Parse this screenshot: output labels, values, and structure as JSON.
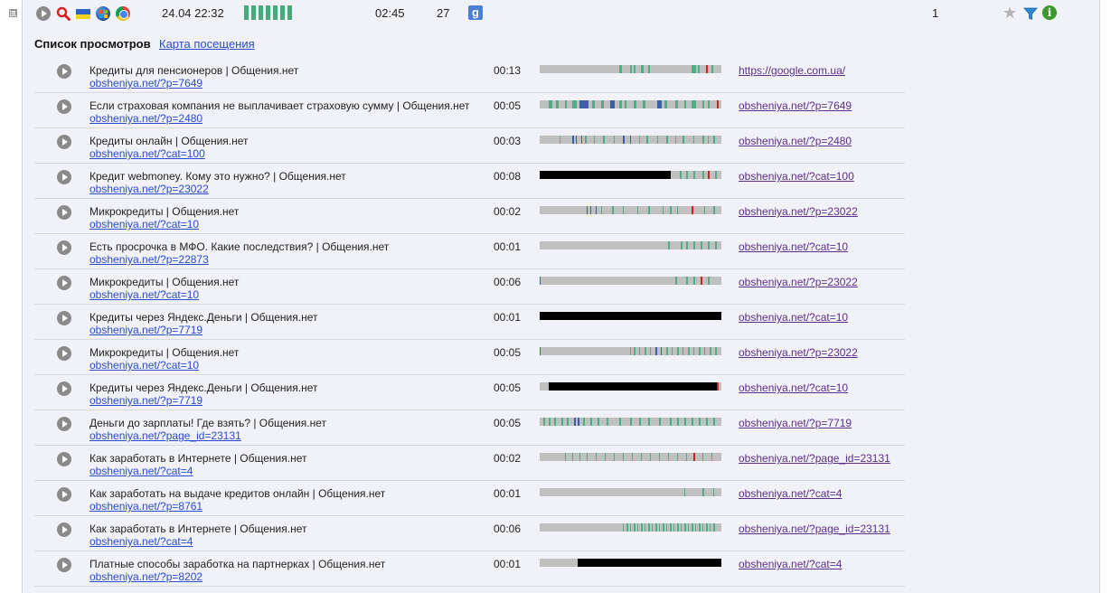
{
  "session": {
    "toggle": "⊟",
    "datetime": "24.04 22:32",
    "activity_bar_count": 7,
    "duration": "02:45",
    "pageviews": "27",
    "search_engine_icon": "g",
    "visits": "1",
    "icons": [
      "play-icon",
      "search-icon",
      "flag-ua-icon",
      "windows7-icon",
      "chrome-icon",
      "google-icon",
      "star-icon",
      "filter-icon",
      "info-icon"
    ]
  },
  "section": {
    "title": "Список просмотров",
    "map_link": "Карта посещения"
  },
  "colors": {
    "link": "#2a4ccc",
    "visited_link": "#5c2f8a",
    "timeline_idle": "#c0c0c0",
    "timeline_active": "#4fae86",
    "timeline_scroll": "#3b5fa8",
    "timeline_click": "#cc2222",
    "timeline_absent": "#000000"
  },
  "views": [
    {
      "title": "Кредиты для пенсионеров | Общения.нет",
      "url": "obsheniya.net/?p=7649",
      "duration": "00:13",
      "referrer": "https://google.com.ua/"
    },
    {
      "title": "Если страховая компания не выплачивает страховую сумму | Общения.нет",
      "url": "obsheniya.net/?p=2480",
      "duration": "00:05",
      "referrer": "obsheniya.net/?p=7649"
    },
    {
      "title": "Кредиты онлайн | Общения.нет",
      "url": "obsheniya.net/?cat=100",
      "duration": "00:03",
      "referrer": "obsheniya.net/?p=2480"
    },
    {
      "title": "Кредит webmoney. Кому это нужно? | Общения.нет",
      "url": "obsheniya.net/?p=23022",
      "duration": "00:08",
      "referrer": "obsheniya.net/?cat=100"
    },
    {
      "title": "Микрокредиты | Общения.нет",
      "url": "obsheniya.net/?cat=10",
      "duration": "00:02",
      "referrer": "obsheniya.net/?p=23022"
    },
    {
      "title": "Есть просрочка в МФО. Какие последствия? | Общения.нет",
      "url": "obsheniya.net/?p=22873",
      "duration": "00:01",
      "referrer": "obsheniya.net/?cat=10"
    },
    {
      "title": "Микрокредиты | Общения.нет",
      "url": "obsheniya.net/?cat=10",
      "duration": "00:06",
      "referrer": "obsheniya.net/?p=23022"
    },
    {
      "title": "Кредиты через Яндекс.Деньги | Общения.нет",
      "url": "obsheniya.net/?p=7719",
      "duration": "00:01",
      "referrer": "obsheniya.net/?cat=10"
    },
    {
      "title": "Микрокредиты | Общения.нет",
      "url": "obsheniya.net/?cat=10",
      "duration": "00:05",
      "referrer": "obsheniya.net/?p=23022"
    },
    {
      "title": "Кредиты через Яндекс.Деньги | Общения.нет",
      "url": "obsheniya.net/?p=7719",
      "duration": "00:05",
      "referrer": "obsheniya.net/?cat=10"
    },
    {
      "title": "Деньги до зарплаты! Где взять? | Общения.нет",
      "url": "obsheniya.net/?page_id=23131",
      "duration": "00:05",
      "referrer": "obsheniya.net/?p=7719"
    },
    {
      "title": "Как заработать в Интернете | Общения.нет",
      "url": "obsheniya.net/?cat=4",
      "duration": "00:02",
      "referrer": "obsheniya.net/?page_id=23131"
    },
    {
      "title": "Как заработать на выдаче кредитов онлайн | Общения.нет",
      "url": "obsheniya.net/?p=8761",
      "duration": "00:01",
      "referrer": "obsheniya.net/?cat=4"
    },
    {
      "title": "Как заработать в Интернете | Общения.нет",
      "url": "obsheniya.net/?cat=4",
      "duration": "00:06",
      "referrer": "obsheniya.net/?page_id=23131"
    },
    {
      "title": "Платные способы заработка на партнерках | Общения.нет",
      "url": "obsheniya.net/?p=8202",
      "duration": "00:01",
      "referrer": "obsheniya.net/?cat=4"
    }
  ]
}
